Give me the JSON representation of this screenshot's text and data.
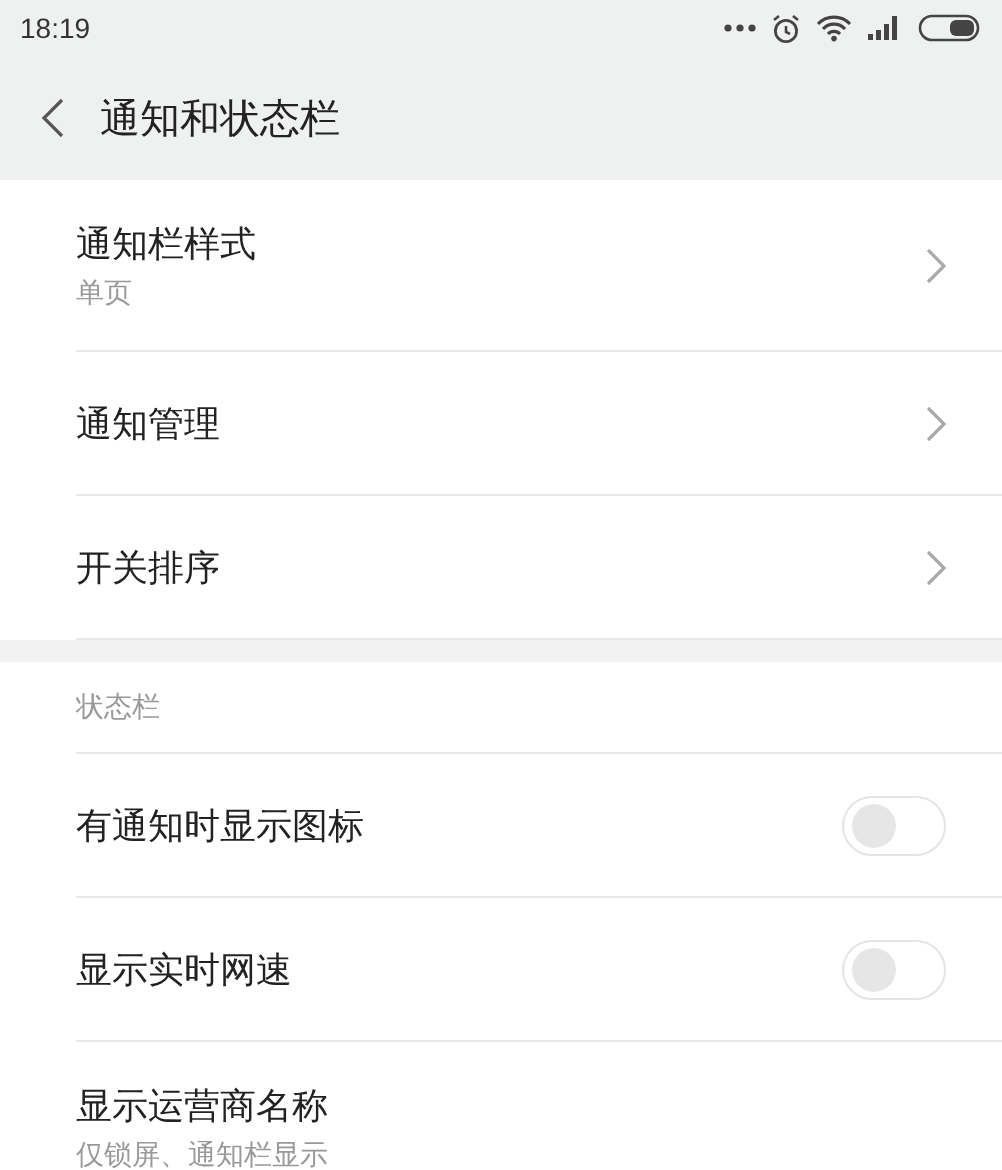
{
  "status_bar": {
    "time": "18:19"
  },
  "header": {
    "title": "通知和状态栏"
  },
  "groups": [
    {
      "items": [
        {
          "kind": "link",
          "title": "通知栏样式",
          "subtitle": "单页"
        },
        {
          "kind": "link",
          "title": "通知管理"
        },
        {
          "kind": "link",
          "title": "开关排序"
        }
      ]
    },
    {
      "heading": "状态栏",
      "items": [
        {
          "kind": "toggle",
          "title": "有通知时显示图标",
          "on": false
        },
        {
          "kind": "toggle",
          "title": "显示实时网速",
          "on": false
        },
        {
          "kind": "plain",
          "title": "显示运营商名称",
          "subtitle": "仅锁屏、通知栏显示"
        }
      ]
    }
  ]
}
